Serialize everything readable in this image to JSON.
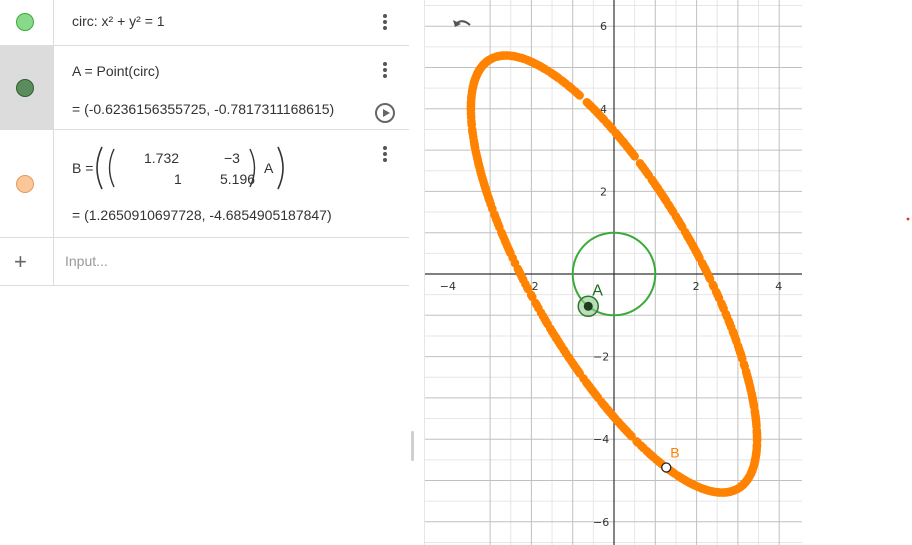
{
  "algebra": {
    "circ": {
      "label": "circ: x² + y² = 1",
      "color": "#89d98a"
    },
    "pointA": {
      "definition": "A  =  Point(circ)",
      "value": "=  (-0.6236156355725, -0.7817311168615)",
      "color": "#5a8d5b"
    },
    "pointB": {
      "name": "B  =",
      "matrix": [
        [
          "1.732",
          "−3"
        ],
        [
          "1",
          "5.196"
        ]
      ],
      "operand": "A",
      "value": "=  (1.2650910697728, -4.6854905187847)",
      "color": "#fbc69a"
    },
    "input": {
      "placeholder": "Input..."
    }
  },
  "graphics": {
    "x_ticks": [
      "−4",
      "−2",
      "2",
      "4"
    ],
    "y_ticks": [
      "6",
      "4",
      "2",
      "−2",
      "−4",
      "−6"
    ],
    "labelA": "A",
    "labelB": "B",
    "colors": {
      "circle": "#3aaa3a",
      "trace": "#ff8200",
      "pointA": "#2c7a2c",
      "grid_major": "#c0c0c0",
      "grid_minor": "#e6e6e6",
      "axis": "#333333",
      "labelA": "#1d6b1d",
      "labelB": "#ff8200"
    },
    "math": {
      "circle_radius": 1,
      "matrix": [
        [
          1.732,
          -3
        ],
        [
          1,
          5.196
        ]
      ],
      "A": [
        -0.6236156355725,
        -0.7817311168615
      ],
      "B": [
        1.2650910697728,
        -4.6854905187847
      ]
    }
  }
}
